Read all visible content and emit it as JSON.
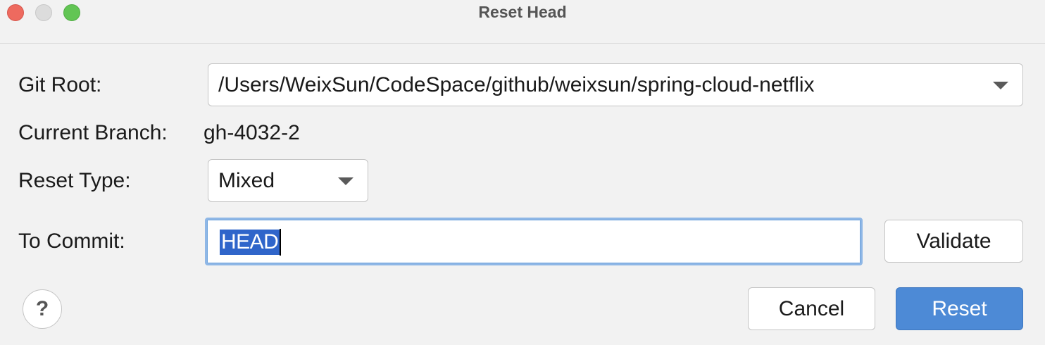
{
  "window": {
    "title": "Reset Head"
  },
  "form": {
    "git_root_label": "Git Root:",
    "git_root_value": "/Users/WeixSun/CodeSpace/github/weixsun/spring-cloud-netflix",
    "current_branch_label": "Current Branch:",
    "current_branch_value": "gh-4032-2",
    "reset_type_label": "Reset Type:",
    "reset_type_value": "Mixed",
    "to_commit_label": "To Commit:",
    "to_commit_value": "HEAD",
    "validate_label": "Validate"
  },
  "footer": {
    "help_glyph": "?",
    "cancel_label": "Cancel",
    "reset_label": "Reset"
  },
  "colors": {
    "accent": "#4d8ad6",
    "selection": "#2f65ca",
    "focus_ring": "#8fb7e6"
  },
  "icons": {
    "dropdown": "chevron-down-icon",
    "help": "help-icon"
  }
}
